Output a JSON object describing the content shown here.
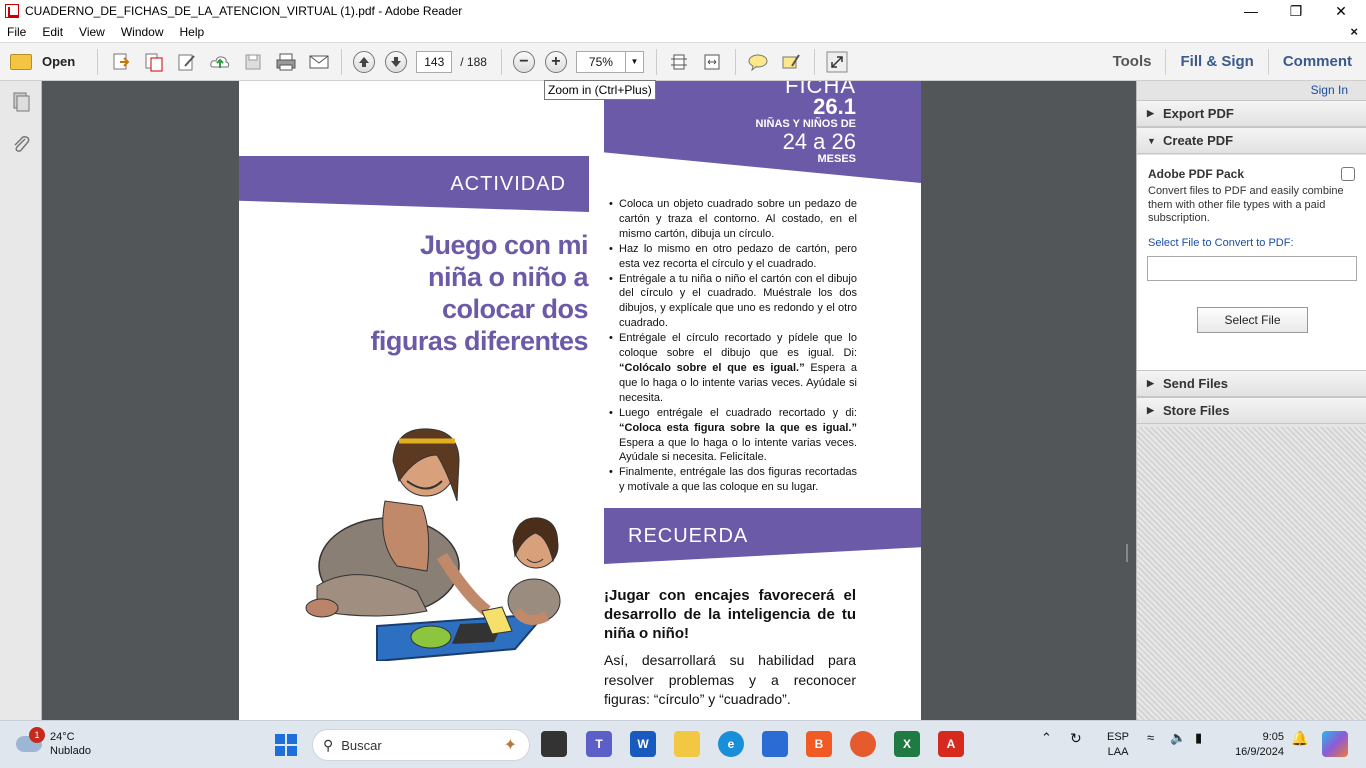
{
  "window": {
    "title": "CUADERNO_DE_FICHAS_DE_LA_ATENCION_VIRTUAL (1).pdf - Adobe Reader",
    "minimize": "—",
    "maximize": "❐",
    "close": "✕"
  },
  "menu": {
    "items": [
      "File",
      "Edit",
      "View",
      "Window",
      "Help"
    ],
    "close": "×"
  },
  "toolbar": {
    "open_label": "Open",
    "page_current": "143",
    "page_total": "/  188",
    "zoom_value": "75%",
    "tools_label": "Tools",
    "fill_sign_label": "Fill & Sign",
    "comment_label": "Comment",
    "tooltip": "Zoom in (Ctrl+Plus)"
  },
  "document": {
    "ficha_word": "FICHA",
    "ficha_number": "26.1",
    "ficha_group": "NIÑAS Y NIÑOS DE",
    "ficha_range": "24 a 26",
    "ficha_unit": "MESES",
    "actividad": "ACTIVIDAD",
    "headline": [
      "Juego con mi",
      "niña o niño a",
      "colocar dos",
      "figuras diferentes"
    ],
    "bullets": [
      {
        "pre": "Coloca un objeto cuadrado sobre un pedazo de cartón y traza el contorno. Al costado, en el mismo cartón, dibuja un círculo.",
        "bold": "",
        "post": ""
      },
      {
        "pre": "Haz lo mismo en otro pedazo de cartón, pero esta vez recorta el círculo y el cuadrado.",
        "bold": "",
        "post": ""
      },
      {
        "pre": "Entrégale a tu niña o niño el cartón con el dibujo del círculo y el cuadrado. Muéstrale los dos dibujos, y explícale que uno es redondo y el otro cuadrado.",
        "bold": "",
        "post": ""
      },
      {
        "pre": "Entrégale el círculo recortado y pídele que lo coloque sobre el dibujo que es igual. Di: ",
        "bold": "“Colócalo sobre el que es igual.”",
        "post": " Espera a que lo haga o lo intente varias veces. Ayúdale si necesita."
      },
      {
        "pre": "Luego entrégale el cuadrado recortado y di: ",
        "bold": "“Coloca esta figura sobre la que es igual.”",
        "post": " Espera a que lo haga o lo intente varias veces. Ayúdale si necesita. Felicítale."
      },
      {
        "pre": "Finalmente, entrégale las dos figuras recortadas y motívale a que las coloque en su lugar.",
        "bold": "",
        "post": ""
      }
    ],
    "recuerda": "RECUERDA",
    "recuerda_bold": "¡Jugar con encajes favorecerá el desarrollo de la inteligencia de tu niña o niño!",
    "recuerda_text": "Así, desarrollará su habilidad para resolver problemas y a reconocer figuras: “círculo” y “cuadrado”."
  },
  "right_panel": {
    "sign_in": "Sign In",
    "export_pdf": "Export PDF",
    "create_pdf": "Create PDF",
    "pack_title": "Adobe PDF Pack",
    "pack_desc": "Convert files to PDF and easily combine them with other file types with a paid subscription.",
    "select_label": "Select File to Convert to PDF:",
    "select_button": "Select File",
    "send_files": "Send Files",
    "store_files": "Store Files"
  },
  "taskbar": {
    "weather_temp": "24°C",
    "weather_desc": "Nublado",
    "weather_badge": "1",
    "search_placeholder": "Buscar",
    "lang_top": "ESP",
    "lang_bottom": "LAA",
    "time": "9:05",
    "date": "16/9/2024"
  }
}
